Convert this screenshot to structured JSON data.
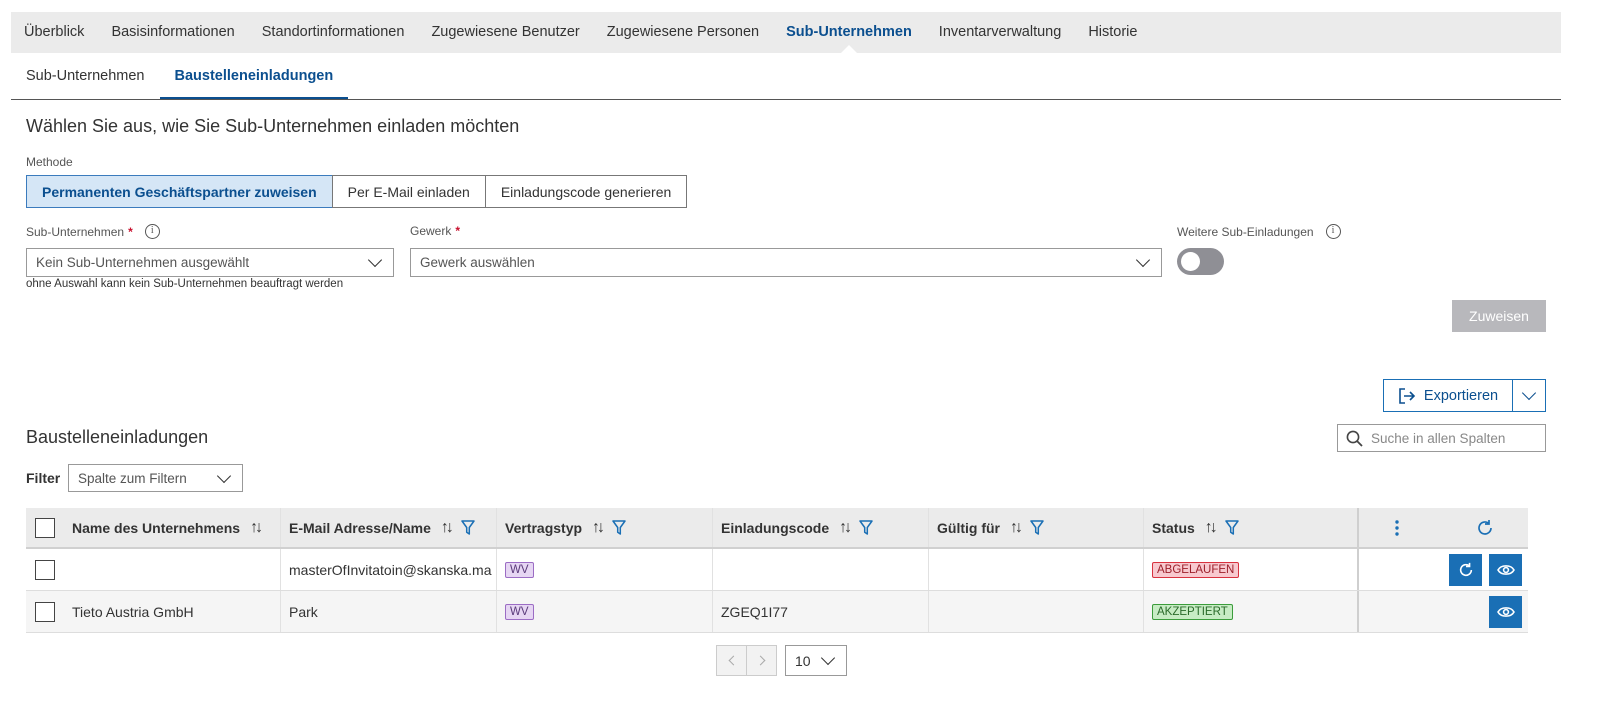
{
  "nav": {
    "items": [
      "Überblick",
      "Basisinformationen",
      "Standortinformationen",
      "Zugewiesene Benutzer",
      "Zugewiesene Personen",
      "Sub-Unternehmen",
      "Inventarverwaltung",
      "Historie"
    ],
    "active": "Sub-Unternehmen"
  },
  "subtabs": {
    "items": [
      "Sub-Unternehmen",
      "Baustelleneinladungen"
    ],
    "active": "Baustelleneinladungen"
  },
  "form": {
    "heading": "Wählen Sie aus, wie Sie Sub-Unternehmen einladen möchten",
    "method_label": "Methode",
    "methods": [
      "Permanenten Geschäftspartner zuweisen",
      "Per E-Mail einladen",
      "Einladungscode generieren"
    ],
    "active_method": "Permanenten Geschäftspartner zuweisen",
    "sub_label": "Sub-Unternehmen",
    "sub_value": "Kein Sub-Unternehmen ausgewählt",
    "sub_hint": "ohne Auswahl kann kein Sub-Unternehmen beauftragt werden",
    "trade_label": "Gewerk",
    "trade_value": "Gewerk auswählen",
    "required_mark": "*",
    "more_label": "Weitere Sub-Einladungen",
    "more_enabled": false,
    "assign_label": "Zuweisen"
  },
  "export": {
    "label": "Exportieren"
  },
  "table": {
    "title": "Baustelleneinladungen",
    "search_placeholder": "Suche in allen Spalten",
    "filter_label": "Filter",
    "filter_placeholder": "Spalte zum Filtern",
    "columns": [
      "Name des Unternehmens",
      "E-Mail Adresse/Name",
      "Vertragstyp",
      "Einladungscode",
      "Gültig für",
      "Status"
    ],
    "rows": [
      {
        "name": "",
        "email": "masterOfInvitatoin@skanska.ma",
        "type": "WV",
        "code": "",
        "valid": "",
        "status": "ABGELAUFEN",
        "status_kind": "expired"
      },
      {
        "name": "Tieto Austria GmbH",
        "email": "Park",
        "type": "WV",
        "code": "ZGEQ1I77",
        "valid": "",
        "status": "AKZEPTIERT",
        "status_kind": "accepted"
      }
    ]
  },
  "pagination": {
    "page_size": "10"
  },
  "colors": {
    "accent": "#0b4f8f",
    "button_blue": "#1a6fb5",
    "expired": "#d8323f",
    "accepted": "#3b9c3b",
    "wv": "#9b6cc4"
  }
}
